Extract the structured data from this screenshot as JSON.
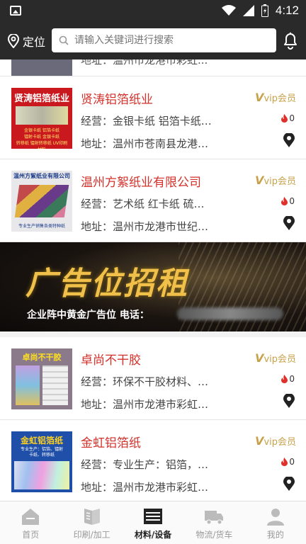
{
  "status_bar": {
    "time": "4:12"
  },
  "header": {
    "location_label": "定位",
    "search_placeholder": "请输入关键词进行搜索"
  },
  "partial_row": {
    "text": "地址：温州市龙港市彩虹..."
  },
  "listings": [
    {
      "name": "贤涛铝箔纸业",
      "business": "经营：金银卡纸 铝箔卡纸…",
      "address": "地址：温州市苍南县龙港…",
      "vip_prefix": "V",
      "vip_label": "vip会员",
      "hot_count": "0",
      "thumb_title": "贤涛铝箔纸业",
      "thumb_lines": [
        "金银卡纸  铝箔卡纸",
        "镭射卡纸  金银卡纸",
        "转移纸  镭射转移纸  UV印刷材料"
      ],
      "thumb_bg": "#c9181e"
    },
    {
      "name": "温州方絮纸业有限公司",
      "business": "经营：艺术纸 红卡纸 硫…",
      "address": "地址：温州市龙港市世纪…",
      "vip_prefix": "V",
      "vip_label": "vip会员",
      "hot_count": "0",
      "thumb_title": "温州方絮纸业有限公司",
      "thumb_lines": [
        "专业生产销售各类特种纸"
      ],
      "thumb_bg": "#e8e8ea"
    }
  ],
  "banner": {
    "headline": "广告位招租",
    "subline": "企业阵中黄金广告位    电话："
  },
  "listings2": [
    {
      "name": "卓尚不干胶",
      "business": "经营：环保不干胶材料、…",
      "address": "地址：温州市龙港市彩虹…",
      "vip_prefix": "V",
      "vip_label": "vip会员",
      "hot_count": "0",
      "thumb_title": "卓尚不干胶",
      "thumb_lines": [],
      "thumb_bg": "#8a7a8a"
    },
    {
      "name": "金虹铝箔纸",
      "business": "经营：专业生产：铝箔，…",
      "address": "地址：温州市龙港市彩虹…",
      "vip_prefix": "V",
      "vip_label": "vip会员",
      "hot_count": "0",
      "thumb_title": "金虹铝箔纸",
      "thumb_lines": [
        "专业生产：铝箔、镭射",
        "卡纸、转移纸"
      ],
      "thumb_bg": "#1f4fa8"
    }
  ],
  "tabs": [
    {
      "label": "首页",
      "icon": "home-icon"
    },
    {
      "label": "印刷/加工",
      "icon": "print-icon"
    },
    {
      "label": "材料/设备",
      "icon": "materials-icon",
      "active": true
    },
    {
      "label": "物流/货车",
      "icon": "truck-icon"
    },
    {
      "label": "我的",
      "icon": "profile-icon"
    }
  ],
  "colors": {
    "accent_red": "#d4302a",
    "vip_gold": "#c8a24a",
    "header_bg": "#2a2a2a"
  }
}
